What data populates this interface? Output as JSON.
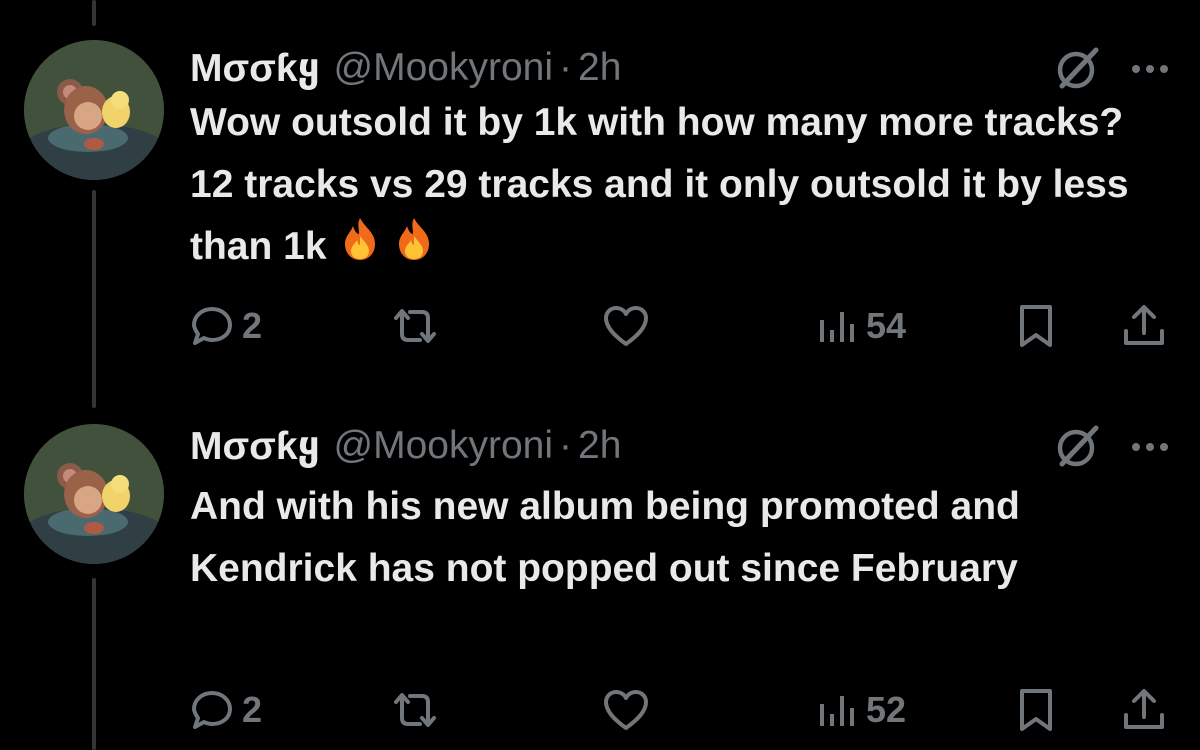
{
  "tweets": [
    {
      "display_name": "Mσσƙყ",
      "handle": "@Mookyroni",
      "separator": "·",
      "time": "2h",
      "text": "Wow outsold it by 1k with how many more tracks? 12 tracks vs 29 tracks and it only outsold it by less than 1k",
      "emoji": [
        "fire-emoji",
        "fire-emoji"
      ],
      "replies": "2",
      "views": "54"
    },
    {
      "display_name": "Mσσƙყ",
      "handle": "@Mookyroni",
      "separator": "·",
      "time": "2h",
      "text": "And with his new album being promoted and Kendrick has not popped out since February",
      "replies": "2",
      "views": "52"
    }
  ],
  "icons": {
    "reply": "speech-bubble-icon",
    "retweet": "repost-icon",
    "like": "heart-icon",
    "views": "bar-chart-icon",
    "bookmark": "bookmark-icon",
    "share": "share-icon",
    "grok": "grok-icon",
    "more": "more-dots-icon"
  },
  "colors": {
    "background": "#000000",
    "text": "#e7e9ea",
    "muted": "#71767b",
    "thread_line": "#333639"
  }
}
